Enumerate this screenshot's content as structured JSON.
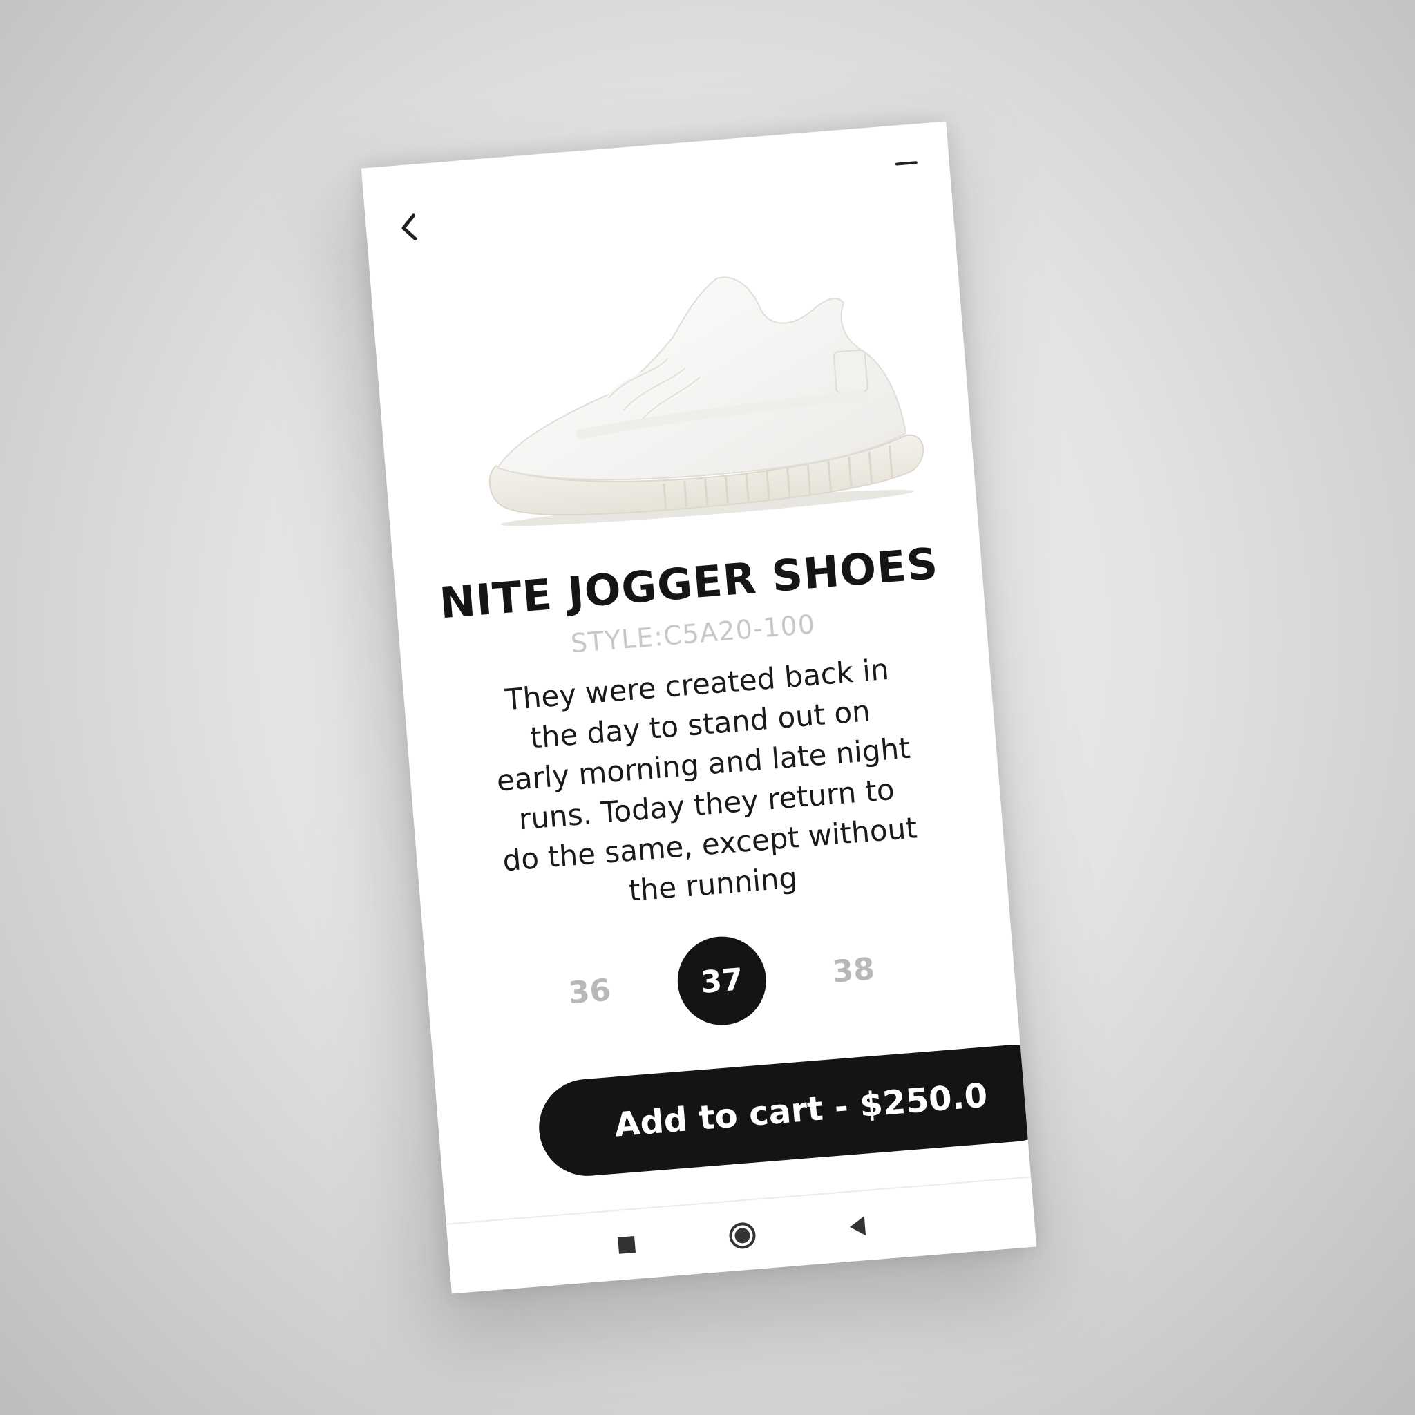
{
  "product": {
    "name": "NITE JOGGER SHOES",
    "style_code": "STYLE:C5A20-100",
    "description": "They were created back in the day to stand out on early morning and late night runs. Today they return to do the same, except without the running"
  },
  "sizes": {
    "options": [
      "36",
      "37",
      "38"
    ],
    "selected": "37"
  },
  "cart_button": {
    "label": "Add to cart - $250.0"
  },
  "icons": {
    "back": "chevron-left-icon",
    "menu": "minus-icon",
    "nav_recents": "square-icon",
    "nav_home": "circle-icon",
    "nav_back": "triangle-left-icon"
  },
  "colors": {
    "primary": "#141414",
    "muted_text": "#b8b8b8",
    "background": "#ffffff"
  }
}
